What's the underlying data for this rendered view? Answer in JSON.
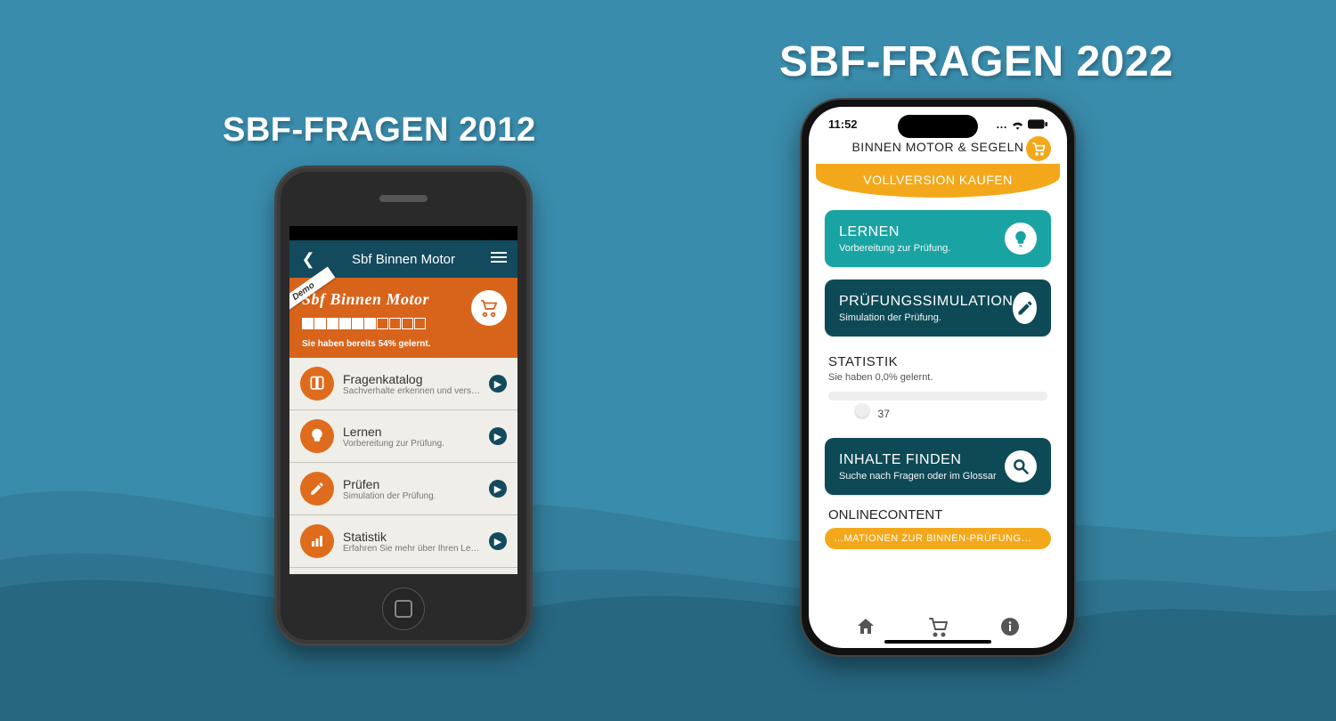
{
  "headings": {
    "y2012": "SBF-Fragen 2012",
    "y2022": "SBF-Fragen 2022"
  },
  "old": {
    "nav_title": "Sbf Binnen Motor",
    "ribbon": "Demo",
    "header_title": "Sbf Binnen Motor",
    "progress_filled": 6,
    "progress_total": 10,
    "progress_text": "Sie haben bereits 54% gelernt.",
    "items": [
      {
        "title": "Fragenkatalog",
        "sub": "Sachverhalte erkennen und verste…",
        "icon": "book"
      },
      {
        "title": "Lernen",
        "sub": "Vorbereitung zur Prüfung.",
        "icon": "bulb"
      },
      {
        "title": "Prüfen",
        "sub": "Simulation der Prüfung.",
        "icon": "pencil"
      },
      {
        "title": "Statistik",
        "sub": "Erfahren Sie mehr über Ihren Lerns…",
        "icon": "stats"
      }
    ]
  },
  "new": {
    "time": "11:52",
    "app_title": "BINNEN MOTOR & SEGELN",
    "banner": "VOLLVERSION KAUFEN",
    "cards": {
      "lernen": {
        "title": "LERNEN",
        "sub": "Vorbereitung zur Prüfung."
      },
      "pruefen": {
        "title": "PRÜFUNGSSIMULATION",
        "sub": "Simulation der Prüfung."
      },
      "inhalte": {
        "title": "INHALTE FINDEN",
        "sub": "Suche nach Fragen oder im Glossar"
      }
    },
    "stat": {
      "title": "STATISTIK",
      "sub": "Sie haben 0,0% gelernt.",
      "value": "37",
      "knob_pct": 12
    },
    "online_title": "ONLINECONTENT",
    "info_chip": "…MATIONEN ZUR BINNEN-PRÜFUNG…"
  }
}
